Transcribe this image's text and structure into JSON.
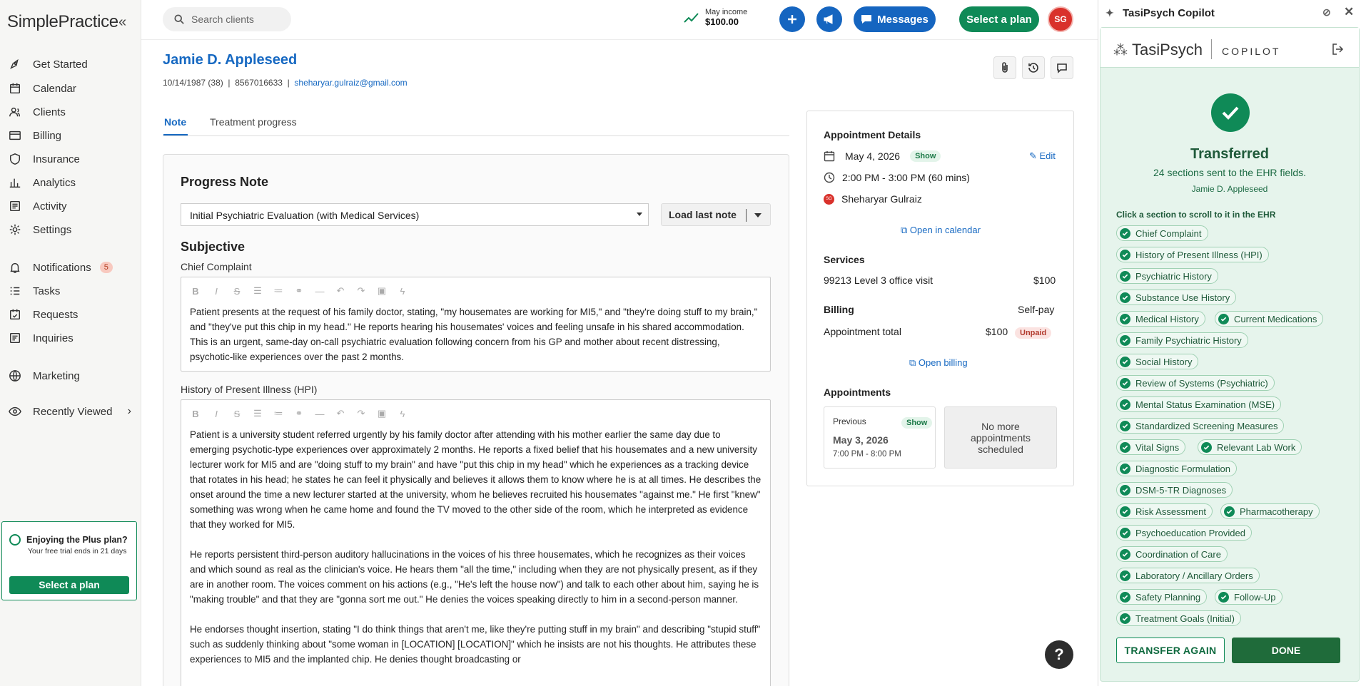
{
  "sidebar": {
    "logo": "SimplePractice",
    "collapse": "«",
    "items": [
      {
        "label": "Get Started"
      },
      {
        "label": "Calendar"
      },
      {
        "label": "Clients"
      },
      {
        "label": "Billing"
      },
      {
        "label": "Insurance"
      },
      {
        "label": "Analytics"
      },
      {
        "label": "Activity"
      },
      {
        "label": "Settings"
      },
      {
        "label": "Notifications",
        "badge": "5"
      },
      {
        "label": "Tasks"
      },
      {
        "label": "Requests"
      },
      {
        "label": "Inquiries"
      },
      {
        "label": "Marketing"
      },
      {
        "label": "Recently Viewed"
      }
    ],
    "plan_card": {
      "title": "Enjoying the Plus plan?",
      "subtitle": "Your free trial ends in 21 days",
      "button": "Select a plan"
    }
  },
  "header": {
    "search_placeholder": "Search clients",
    "income_label": "May income",
    "income_value": "$100.00",
    "messages": "Messages",
    "select_plan": "Select a plan",
    "avatar": "SG"
  },
  "client": {
    "name": "Jamie D. Appleseed",
    "dob": "10/14/1987 (38)",
    "phone": "8567016633",
    "email": "sheharyar.gulraiz@gmail.com"
  },
  "tabs": [
    {
      "label": "Note"
    },
    {
      "label": "Treatment progress"
    }
  ],
  "note": {
    "title": "Progress Note",
    "template": "Initial Psychiatric Evaluation (with Medical Services)",
    "load_last": "Load last note",
    "section": "Subjective",
    "chief_label": "Chief Complaint",
    "chief_text": "Patient presents at the request of his family doctor, stating, \"my housemates are working for MI5,\" and \"they're doing stuff to my brain,\" and \"they've put this chip in my head.\" He reports hearing his housemates' voices and feeling unsafe in his shared accommodation. This is an urgent, same-day on-call psychiatric evaluation following concern from his GP and mother about recent distressing, psychotic-like experiences over the past 2 months.",
    "hpi_label": "History of Present Illness (HPI)",
    "hpi_p1": "Patient is a university student referred urgently by his family doctor after attending with his mother earlier the same day due to emerging psychotic-type experiences over approximately 2 months. He reports a fixed belief that his housemates and a new university lecturer work for MI5 and are \"doing stuff to my brain\" and have \"put this chip in my head\" which he experiences as a tracking device that rotates in his head; he states he can feel it physically and believes it allows them to know where he is at all times. He describes the onset around the time a new lecturer started at the university, whom he believes recruited his housemates \"against me.\" He first \"knew\" something was wrong when he came home and found the TV moved to the other side of the room, which he interpreted as evidence that they worked for MI5.",
    "hpi_p2": "He reports persistent third-person auditory hallucinations in the voices of his three housemates, which he recognizes as their voices and which sound as real as the clinician's voice. He hears them \"all the time,\" including when they are not physically present, as if they are in another room. The voices comment on his actions (e.g., \"He's left the house now\") and talk to each other about him, saying he is \"making trouble\" and that they are \"gonna sort me out.\" He denies the voices speaking directly to him in a second-person manner.",
    "hpi_p3": "He endorses thought insertion, stating \"I do think things that aren't me, like they're putting stuff in my brain\" and describing \"stupid stuff\" such as suddenly thinking about \"some woman in [LOCATION] [LOCATION]\" which he insists are not his thoughts. He attributes these experiences to MI5 and the implanted chip. He denies thought broadcasting or"
  },
  "appointment": {
    "heading": "Appointment Details",
    "date": "May 4, 2026",
    "status": "Show",
    "edit": "Edit",
    "time": "2:00 PM - 3:00 PM (60 mins)",
    "clinician_initials": "SG",
    "clinician": "Sheharyar Gulraiz",
    "open_calendar": "Open in calendar",
    "services_heading": "Services",
    "service": "99213 Level 3 office visit",
    "service_price": "$100",
    "billing_heading": "Billing",
    "billing_type": "Self-pay",
    "total_label": "Appointment total",
    "total_value": "$100",
    "total_status": "Unpaid",
    "open_billing": "Open billing",
    "appts_heading": "Appointments",
    "prev_label": "Previous",
    "prev_status": "Show",
    "prev_date": "May 3, 2026",
    "prev_time": "7:00 PM - 8:00 PM",
    "next_text": "No more appointments scheduled"
  },
  "copilot": {
    "window_title": "TasiPsych Copilot",
    "brand": "TasiPsych",
    "product": "COPILOT",
    "status": "Transferred",
    "summary": "24 sections sent to the EHR fields.",
    "client": "Jamie D. Appleseed",
    "hint": "Click a section to scroll to it in the EHR",
    "sections": [
      "Chief Complaint",
      "History of Present Illness (HPI)",
      "Psychiatric History",
      "Substance Use History",
      "Medical History",
      "Current Medications",
      "Family Psychiatric History",
      "Social History",
      "Review of Systems (Psychiatric)",
      "Mental Status Examination (MSE)",
      "Standardized Screening Measures",
      "Vital Signs",
      "Relevant Lab Work",
      "Diagnostic Formulation",
      "DSM-5-TR Diagnoses",
      "Risk Assessment",
      "Pharmacotherapy",
      "Psychoeducation Provided",
      "Coordination of Care",
      "Laboratory / Ancillary Orders",
      "Safety Planning",
      "Follow-Up",
      "Treatment Goals (Initial)"
    ],
    "transfer_again": "TRANSFER AGAIN",
    "done": "DONE"
  },
  "help": "?",
  "colors": {
    "brand_green": "#0f8a57",
    "brand_blue": "#1565c0",
    "link": "#1769c2"
  }
}
